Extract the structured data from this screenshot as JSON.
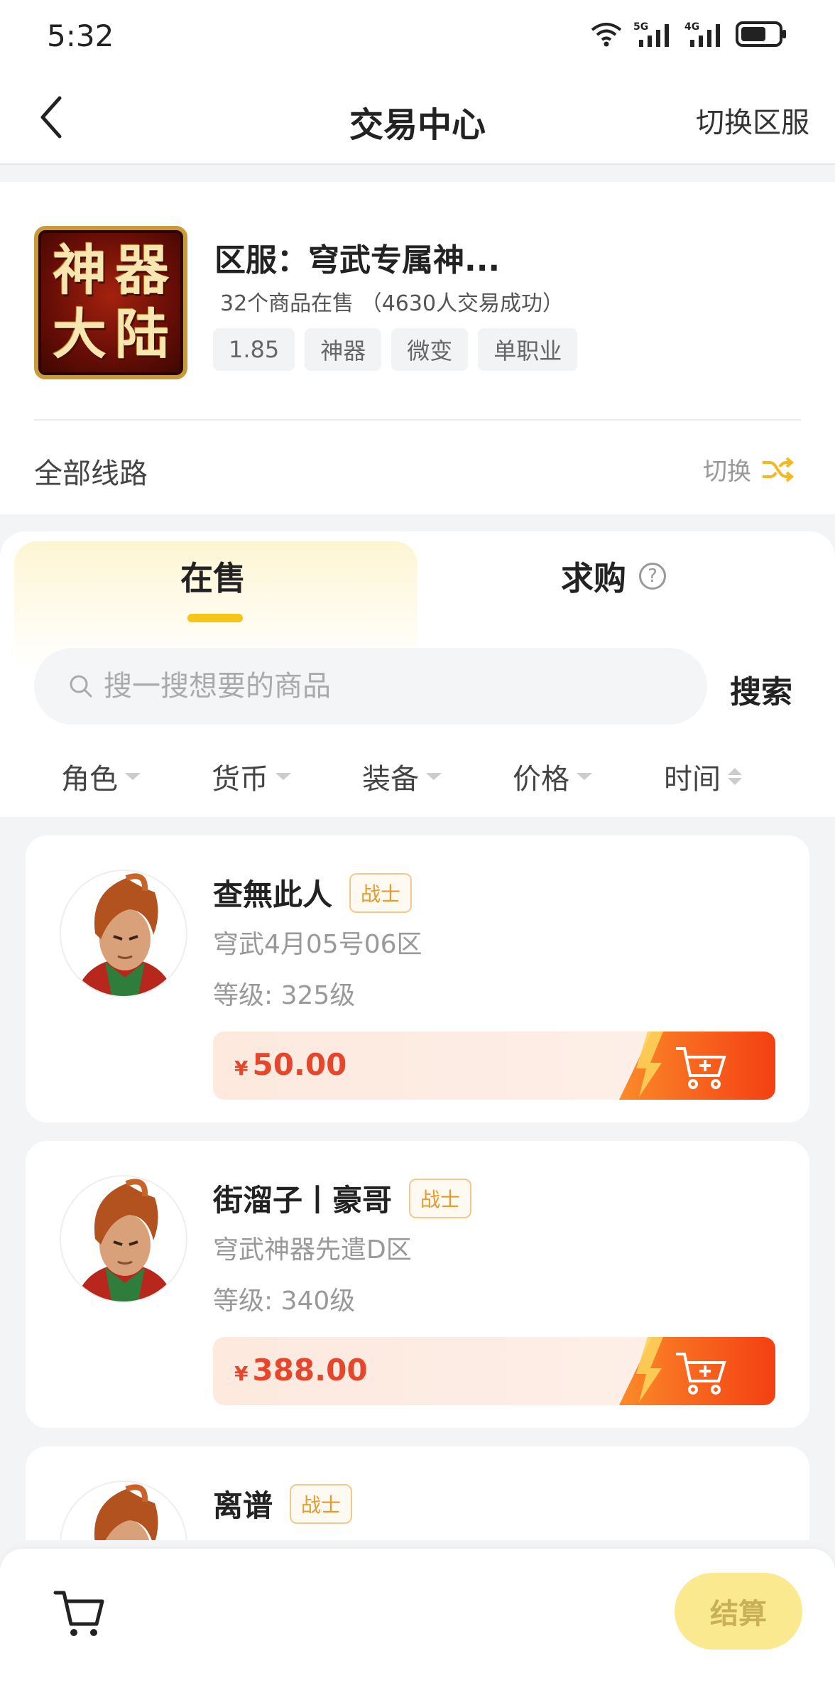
{
  "status_bar": {
    "time": "5:32",
    "net1": "5G",
    "net2": "4G"
  },
  "header": {
    "title": "交易中心",
    "switch_server": "切换区服"
  },
  "server": {
    "logo_chars": [
      "神",
      "器",
      "大",
      "陆"
    ],
    "name": "区服：穹武专属神...",
    "stats": "32个商品在售 （4630人交易成功）",
    "tags": [
      "1.85",
      "神器",
      "微变",
      "单职业"
    ],
    "route_label": "全部线路",
    "route_switch": "切换"
  },
  "tabs": {
    "on_sale": "在售",
    "buy": "求购",
    "help_icon": "question-circle-icon"
  },
  "search": {
    "placeholder": "搜一搜想要的商品",
    "value": "",
    "button": "搜索"
  },
  "filters": [
    "角色",
    "货币",
    "装备",
    "价格",
    "时间"
  ],
  "items": [
    {
      "name": "查無此人",
      "class": "战士",
      "server": "穹武4月05号06区",
      "level": "等级: 325级",
      "currency": "¥",
      "price": "50.00"
    },
    {
      "name": "街溜子丨豪哥",
      "class": "战士",
      "server": "穹武神器先遣D区",
      "level": "等级: 340级",
      "currency": "¥",
      "price": "388.00"
    },
    {
      "name": "离谱",
      "class": "战士",
      "server": "",
      "level": "",
      "currency": "¥",
      "price": ""
    }
  ],
  "bottom": {
    "checkout": "结算"
  },
  "colors": {
    "accent_yellow": "#f5c518",
    "price_red": "#e5472d",
    "cart_orange": "#f5631c",
    "badge_orange": "#e59a2a"
  }
}
